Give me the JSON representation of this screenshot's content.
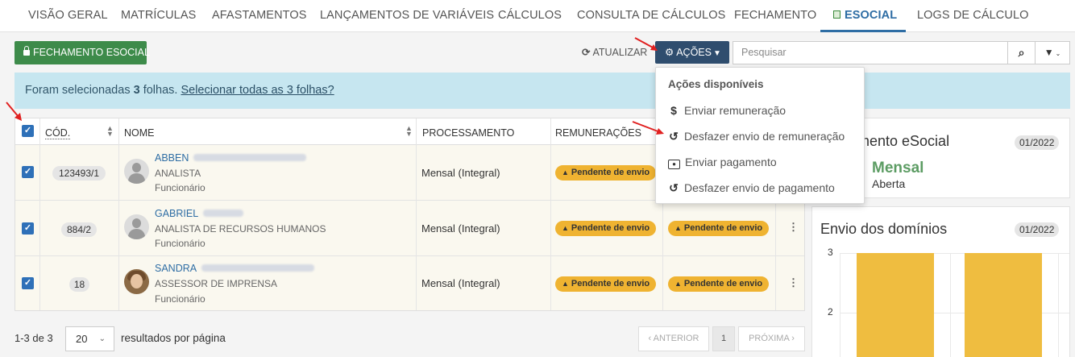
{
  "nav": {
    "tabs": [
      {
        "label": "VISÃO GERAL"
      },
      {
        "label": "MATRÍCULAS"
      },
      {
        "label": "AFASTAMENTOS"
      },
      {
        "label": "LANÇAMENTOS DE VARIÁVEIS"
      },
      {
        "label": "CÁLCULOS"
      },
      {
        "label": "CONSULTA DE CÁLCULOS"
      },
      {
        "label": "FECHAMENTO"
      },
      {
        "label": "ESOCIAL"
      },
      {
        "label": "LOGS DE CÁLCULO"
      }
    ],
    "active_tab": "ESOCIAL"
  },
  "toolbar": {
    "fechamento_label": "FECHAMENTO ESOCIAL",
    "atualizar_label": "ATUALIZAR",
    "acoes_label": "AÇÕES",
    "search_placeholder": "Pesquisar"
  },
  "banner": {
    "prefix": "Foram selecionadas ",
    "count": "3",
    "suffix": " folhas. ",
    "link": "Selecionar todas as 3 folhas?"
  },
  "table": {
    "columns": {
      "cod": "CÓD.",
      "nome": "NOME",
      "processamento": "PROCESSAMENTO",
      "remuneracoes": "REMUNERAÇÕES"
    },
    "rows": [
      {
        "cod": "123493/1",
        "first_name": "ABBEN",
        "role": "ANALISTA",
        "type": "Funcionário",
        "processamento": "Mensal (Integral)",
        "remuneracao": "Pendente de envio",
        "pagamento": ""
      },
      {
        "cod": "884/2",
        "first_name": "GABRIEL",
        "role": "ANALISTA DE RECURSOS HUMANOS",
        "type": "Funcionário",
        "processamento": "Mensal (Integral)",
        "remuneracao": "Pendente de envio",
        "pagamento": "Pendente de envio"
      },
      {
        "cod": "18",
        "first_name": "SANDRA",
        "role": "ASSESSOR DE IMPRENSA",
        "type": "Funcionário",
        "processamento": "Mensal (Integral)",
        "remuneracao": "Pendente de envio",
        "pagamento": "Pendente de envio"
      }
    ]
  },
  "pagination": {
    "count_text": "1-3 de 3",
    "per_page": "20",
    "per_page_label": "resultados por página",
    "prev": "‹ ANTERIOR",
    "current": "1",
    "next": "PRÓXIMA ›"
  },
  "dropdown": {
    "header": "Ações disponíveis",
    "items": [
      {
        "label": "Enviar remuneração",
        "icon": "dollar-icon"
      },
      {
        "label": "Desfazer envio de remuneração",
        "icon": "undo-icon"
      },
      {
        "label": "Enviar pagamento",
        "icon": "money-icon"
      },
      {
        "label": "Desfazer envio de pagamento",
        "icon": "undo-icon"
      }
    ]
  },
  "fechamento_card": {
    "title": "mento eSocial",
    "period": "01/2022",
    "status": "Mensal",
    "substatus": "Aberta"
  },
  "dominios_card": {
    "title": "Envio dos domínios",
    "period": "01/2022"
  },
  "chart_data": {
    "type": "bar",
    "categories": [
      "",
      ""
    ],
    "values": [
      3,
      3
    ],
    "title": "Envio dos domínios",
    "xlabel": "",
    "ylabel": "",
    "y_ticks_visible": [
      3,
      2
    ],
    "bar_color": "#efbd40"
  },
  "colors": {
    "accent": "#2e6da4",
    "green_button": "#3d8b4a",
    "dark_button": "#2f4d6e",
    "banner": "#c6e6f0",
    "pending_badge": "#efb331",
    "checkbox": "#2e70b8"
  }
}
